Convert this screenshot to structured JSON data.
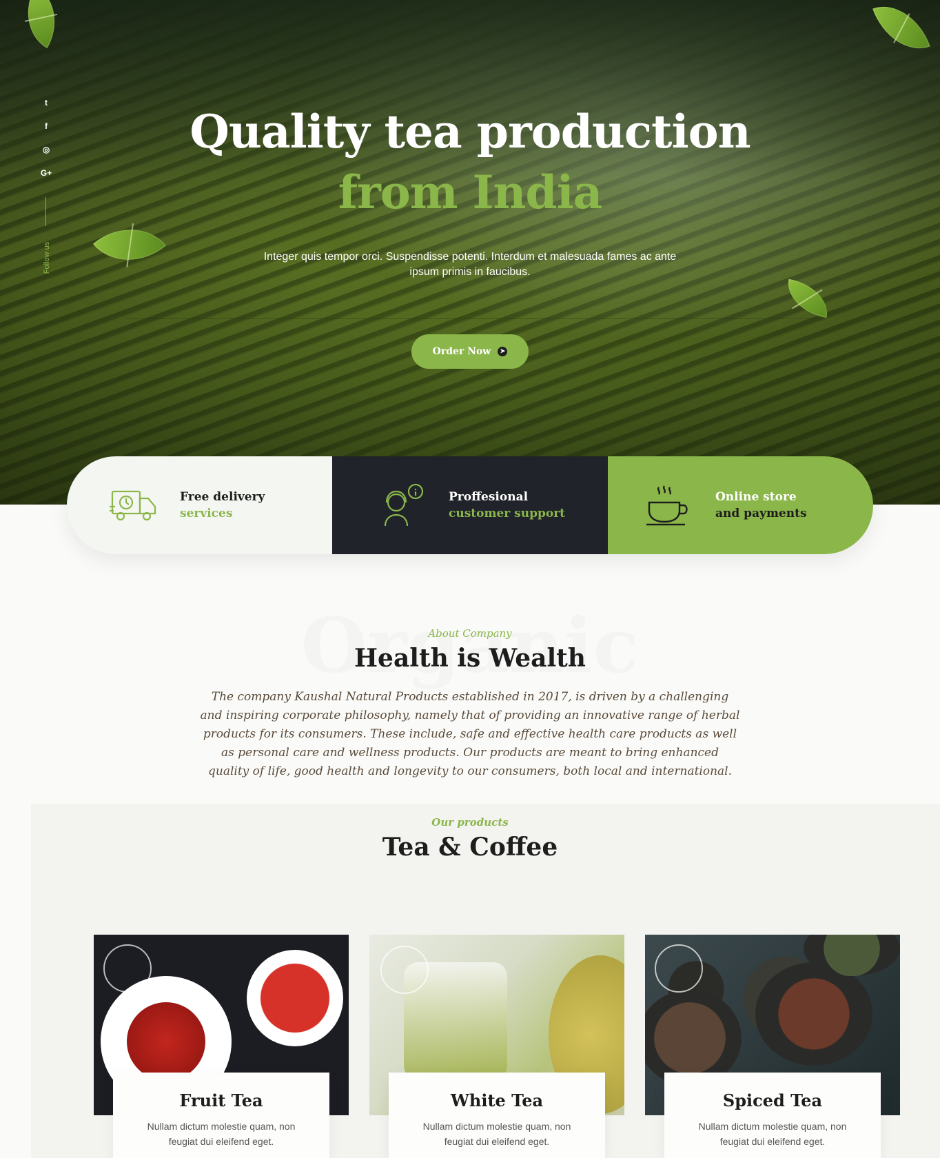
{
  "hero": {
    "title_line1": "Quality tea production",
    "title_line2": "from India",
    "subtitle": "Integer quis tempor orci. Suspendisse potenti. Interdum et malesuada fames ac ante ipsum primis in faucibus.",
    "cta_label": "Order Now"
  },
  "social": {
    "follow_label": "Follow us",
    "icons": [
      "twitter-icon",
      "facebook-icon",
      "instagram-icon",
      "google-plus-icon"
    ],
    "glyphs": [
      "t",
      "f",
      "◎",
      "G+"
    ]
  },
  "features": [
    {
      "line1": "Free delivery",
      "line2": "services",
      "icon": "delivery-truck-icon"
    },
    {
      "line1": "Proffesional",
      "line2": "customer support",
      "icon": "support-agent-icon"
    },
    {
      "line1": "Online store",
      "line2": "and payments",
      "icon": "tea-cup-icon"
    }
  ],
  "about": {
    "watermark": "Organic",
    "kicker": "About Company",
    "title": "Health is Wealth",
    "text": "The company Kaushal Natural Products established in 2017, is driven by a challenging and inspiring corporate philosophy, namely that of providing an innovative range of herbal products for its consumers. These include, safe and effective health care products as well as personal care and wellness products. Our products are meant to bring enhanced quality of life, good health and longevity to our consumers, both local and international."
  },
  "products": {
    "kicker": "Our products",
    "title": "Tea & Coffee",
    "items": [
      {
        "title": "Fruit Tea",
        "desc": "Nullam dictum molestie quam, non feugiat dui eleifend eget."
      },
      {
        "title": "White Tea",
        "desc": "Nullam dictum molestie quam, non feugiat dui eleifend eget."
      },
      {
        "title": "Spiced Tea",
        "desc": "Nullam dictum molestie quam, non feugiat dui eleifend eget."
      }
    ]
  },
  "colors": {
    "accent": "#8bb64a",
    "dark": "#21232a",
    "text": "#1d1d1d"
  }
}
